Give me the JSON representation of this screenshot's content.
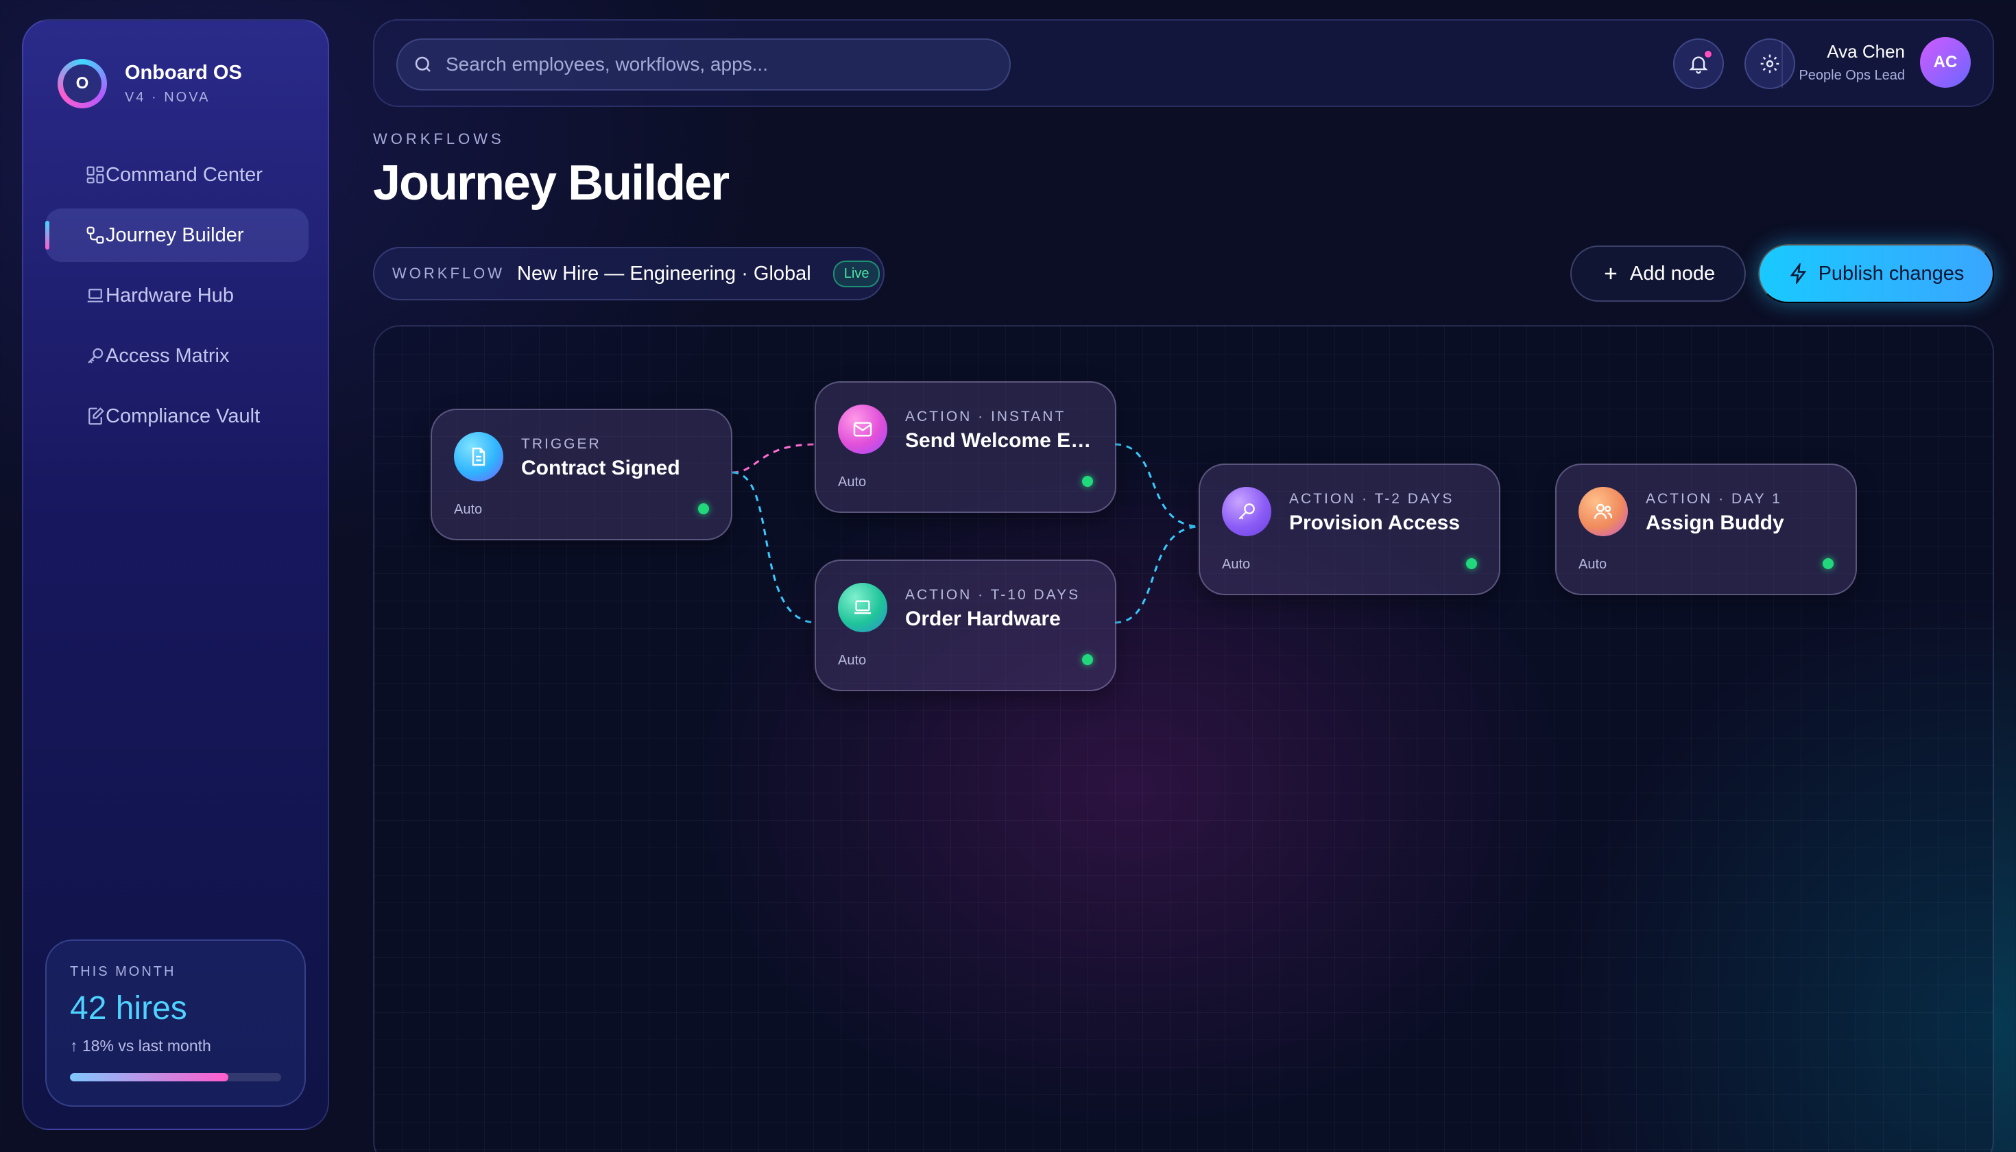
{
  "app": {
    "name": "Onboard OS",
    "version": "V4 · NOVA",
    "logo_letter": "O"
  },
  "sidebar": {
    "items": [
      {
        "label": "Command Center",
        "icon": "grid-icon",
        "active": false
      },
      {
        "label": "Journey Builder",
        "icon": "flow-icon",
        "active": true
      },
      {
        "label": "Hardware Hub",
        "icon": "laptop-icon",
        "active": false
      },
      {
        "label": "Access Matrix",
        "icon": "key-icon",
        "active": false
      },
      {
        "label": "Compliance Vault",
        "icon": "document-edit-icon",
        "active": false
      }
    ],
    "stats": {
      "label": "THIS MONTH",
      "value": "42 hires",
      "delta": "↑ 18% vs last month",
      "progress": 0.75
    }
  },
  "header": {
    "search_placeholder": "Search employees, workflows, apps...",
    "notifications_unread": true,
    "user": {
      "name": "Ava Chen",
      "role": "People Ops Lead",
      "initials": "AC"
    }
  },
  "page": {
    "eyebrow": "WORKFLOWS",
    "title": "Journey Builder",
    "workflow": {
      "label": "WORKFLOW",
      "name": "New Hire — Engineering · Global",
      "status": "Live"
    },
    "add_node_label": "Add node",
    "publish_label": "Publish changes"
  },
  "flow": {
    "nodes": [
      {
        "kind": "TRIGGER",
        "title": "Contract Signed",
        "mode": "Auto",
        "icon": "document-icon",
        "color": "#33c6ff"
      },
      {
        "kind": "ACTION · INSTANT",
        "title": "Send Welcome Em...",
        "mode": "Auto",
        "icon": "mail-icon",
        "color": "#e04fd9"
      },
      {
        "kind": "ACTION · T-10 DAYS",
        "title": "Order Hardware",
        "mode": "Auto",
        "icon": "laptop-icon",
        "color": "#20c49a"
      },
      {
        "kind": "ACTION · T-2 DAYS",
        "title": "Provision Access",
        "mode": "Auto",
        "icon": "key-icon",
        "color": "#8b5cf6"
      },
      {
        "kind": "ACTION · DAY 1",
        "title": "Assign Buddy",
        "mode": "Auto",
        "icon": "users-icon",
        "color": "#f08a5d"
      }
    ],
    "edges": [
      {
        "from": "Contract Signed",
        "to": "Send Welcome Em..."
      },
      {
        "from": "Contract Signed",
        "to": "Order Hardware"
      },
      {
        "from": "Send Welcome Em...",
        "to": "Provision Access"
      },
      {
        "from": "Order Hardware",
        "to": "Provision Access"
      }
    ]
  },
  "colors": {
    "accent_cyan": "#19c9ff",
    "accent_pink": "#ff5ccc",
    "status_live": "#22d87c"
  }
}
